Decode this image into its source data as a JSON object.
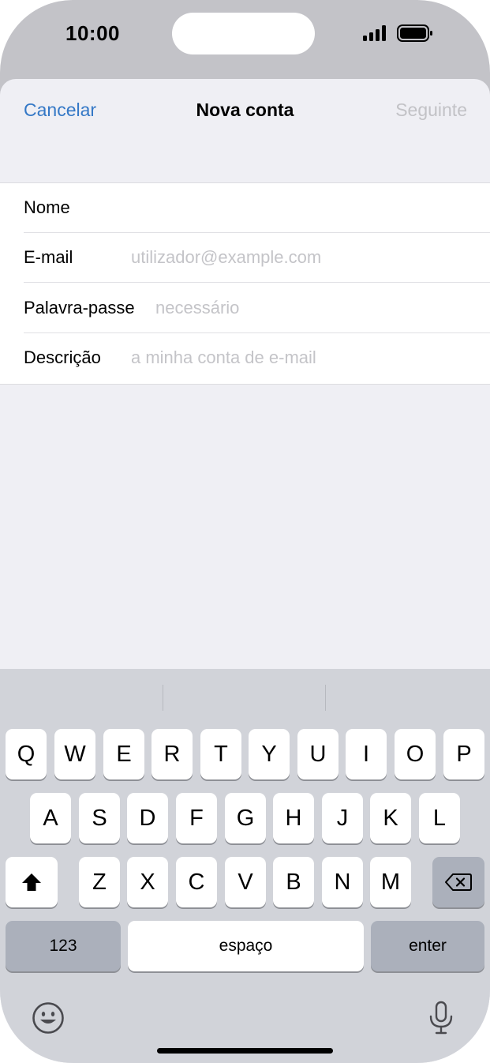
{
  "status": {
    "time": "10:00"
  },
  "nav": {
    "cancel": "Cancelar",
    "title": "Nova conta",
    "next": "Seguinte"
  },
  "form": {
    "name_label": "Nome",
    "email_label": "E-mail",
    "email_placeholder": "utilizador@example.com",
    "password_label": "Palavra-passe",
    "password_placeholder": "necessário",
    "description_label": "Descrição",
    "description_placeholder": "a minha conta de e-mail"
  },
  "keyboard": {
    "row1": [
      "Q",
      "W",
      "E",
      "R",
      "T",
      "Y",
      "U",
      "I",
      "O",
      "P"
    ],
    "row2": [
      "A",
      "S",
      "D",
      "F",
      "G",
      "H",
      "J",
      "K",
      "L"
    ],
    "row3": [
      "Z",
      "X",
      "C",
      "V",
      "B",
      "N",
      "M"
    ],
    "numbers": "123",
    "space": "espaço",
    "enter": "enter"
  },
  "icons": [
    "signal-icon",
    "battery-icon",
    "shift-icon",
    "backspace-icon",
    "emoji-icon",
    "microphone-icon"
  ]
}
